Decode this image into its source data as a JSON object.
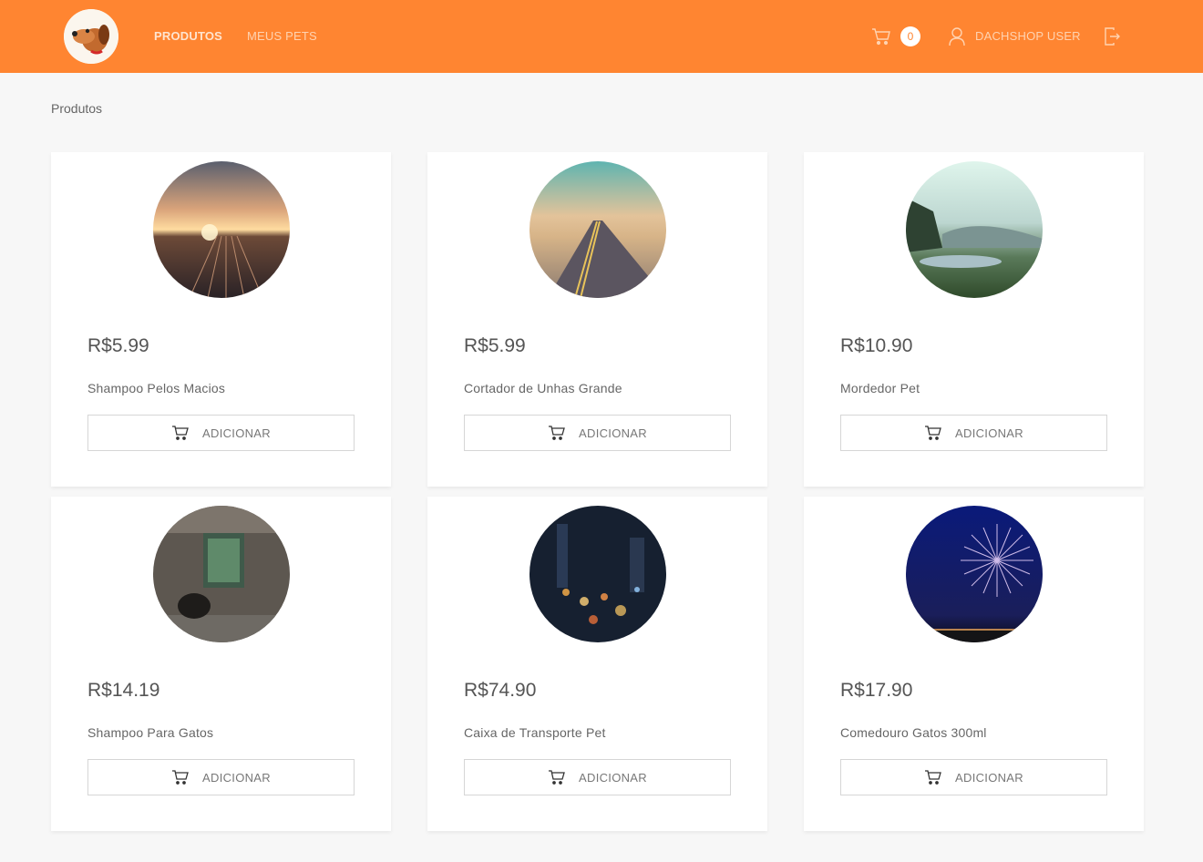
{
  "header": {
    "nav": [
      {
        "label": "PRODUTOS",
        "active": true
      },
      {
        "label": "MEUS PETS",
        "active": false
      }
    ],
    "cart_count": "0",
    "user_name": "DACHSHOP USER",
    "brand_color": "#ff8531"
  },
  "breadcrumb": "Produtos",
  "products": [
    {
      "price": "R$5.99",
      "name": "Shampoo Pelos Macios",
      "button": "ADICIONAR",
      "image": "sunset-railway"
    },
    {
      "price": "R$5.99",
      "name": "Cortador de Unhas Grande",
      "button": "ADICIONAR",
      "image": "desert-road"
    },
    {
      "price": "R$10.90",
      "name": "Mordedor Pet",
      "button": "ADICIONAR",
      "image": "mountain-lake"
    },
    {
      "price": "R$14.19",
      "name": "Shampoo Para Gatos",
      "button": "ADICIONAR",
      "image": "old-building"
    },
    {
      "price": "R$74.90",
      "name": "Caixa de Transporte Pet",
      "button": "ADICIONAR",
      "image": "city-night-bokeh"
    },
    {
      "price": "R$17.90",
      "name": "Comedouro Gatos 300ml",
      "button": "ADICIONAR",
      "image": "fireworks"
    }
  ]
}
